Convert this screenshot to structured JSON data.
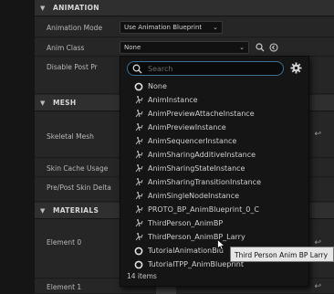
{
  "sections": {
    "animation": "ANIMATION",
    "mesh": "MESH",
    "materials": "MATERIALS"
  },
  "rows": {
    "animation_mode_label": "Animation Mode",
    "animation_mode_value": "Use Animation Blueprint",
    "anim_class_label": "Anim Class",
    "anim_class_value": "None",
    "disable_post_process_label": "Disable Post Proces",
    "skeletal_mesh_label": "Skeletal Mesh",
    "skin_cache_usage_label": "Skin Cache Usage",
    "pre_post_skin_delta_label": "Pre/Post Skin Delta",
    "element0_label": "Element 0",
    "element1_label": "Element 1"
  },
  "dropdown": {
    "search_placeholder": "Search",
    "items": [
      {
        "label": "None",
        "icon": "none-circle-icon"
      },
      {
        "label": "AnimInstance",
        "icon": "anim-class-icon"
      },
      {
        "label": "AnimPreviewAttacheInstance",
        "icon": "anim-class-icon"
      },
      {
        "label": "AnimPreviewInstance",
        "icon": "anim-class-icon"
      },
      {
        "label": "AnimSequencerInstance",
        "icon": "anim-class-icon"
      },
      {
        "label": "AnimSharingAdditiveInstance",
        "icon": "anim-class-icon"
      },
      {
        "label": "AnimSharingStateInstance",
        "icon": "anim-class-icon"
      },
      {
        "label": "AnimSharingTransitionInstance",
        "icon": "anim-class-icon"
      },
      {
        "label": "AnimSingleNodeInstance",
        "icon": "anim-class-icon"
      },
      {
        "label": "PROTO_BP_AnimBlueprint_0_C",
        "icon": "anim-class-icon"
      },
      {
        "label": "ThirdPerson_AnimBP",
        "icon": "anim-class-icon"
      },
      {
        "label": "ThirdPerson_AnimBP_Larry",
        "icon": "anim-class-icon"
      },
      {
        "label": "TutorialAnimationBlu",
        "icon": "none-circle-icon"
      },
      {
        "label": "TutorialTPP_AnimBlueprint",
        "icon": "none-circle-icon"
      }
    ],
    "count_text": "14 items"
  },
  "tooltip": "Third Person Anim BP Larry",
  "colors": {
    "accent": "#3e6f8e",
    "panel_bg": "#242424",
    "header_bg": "#2f2f2f",
    "popup_bg": "#151515"
  }
}
